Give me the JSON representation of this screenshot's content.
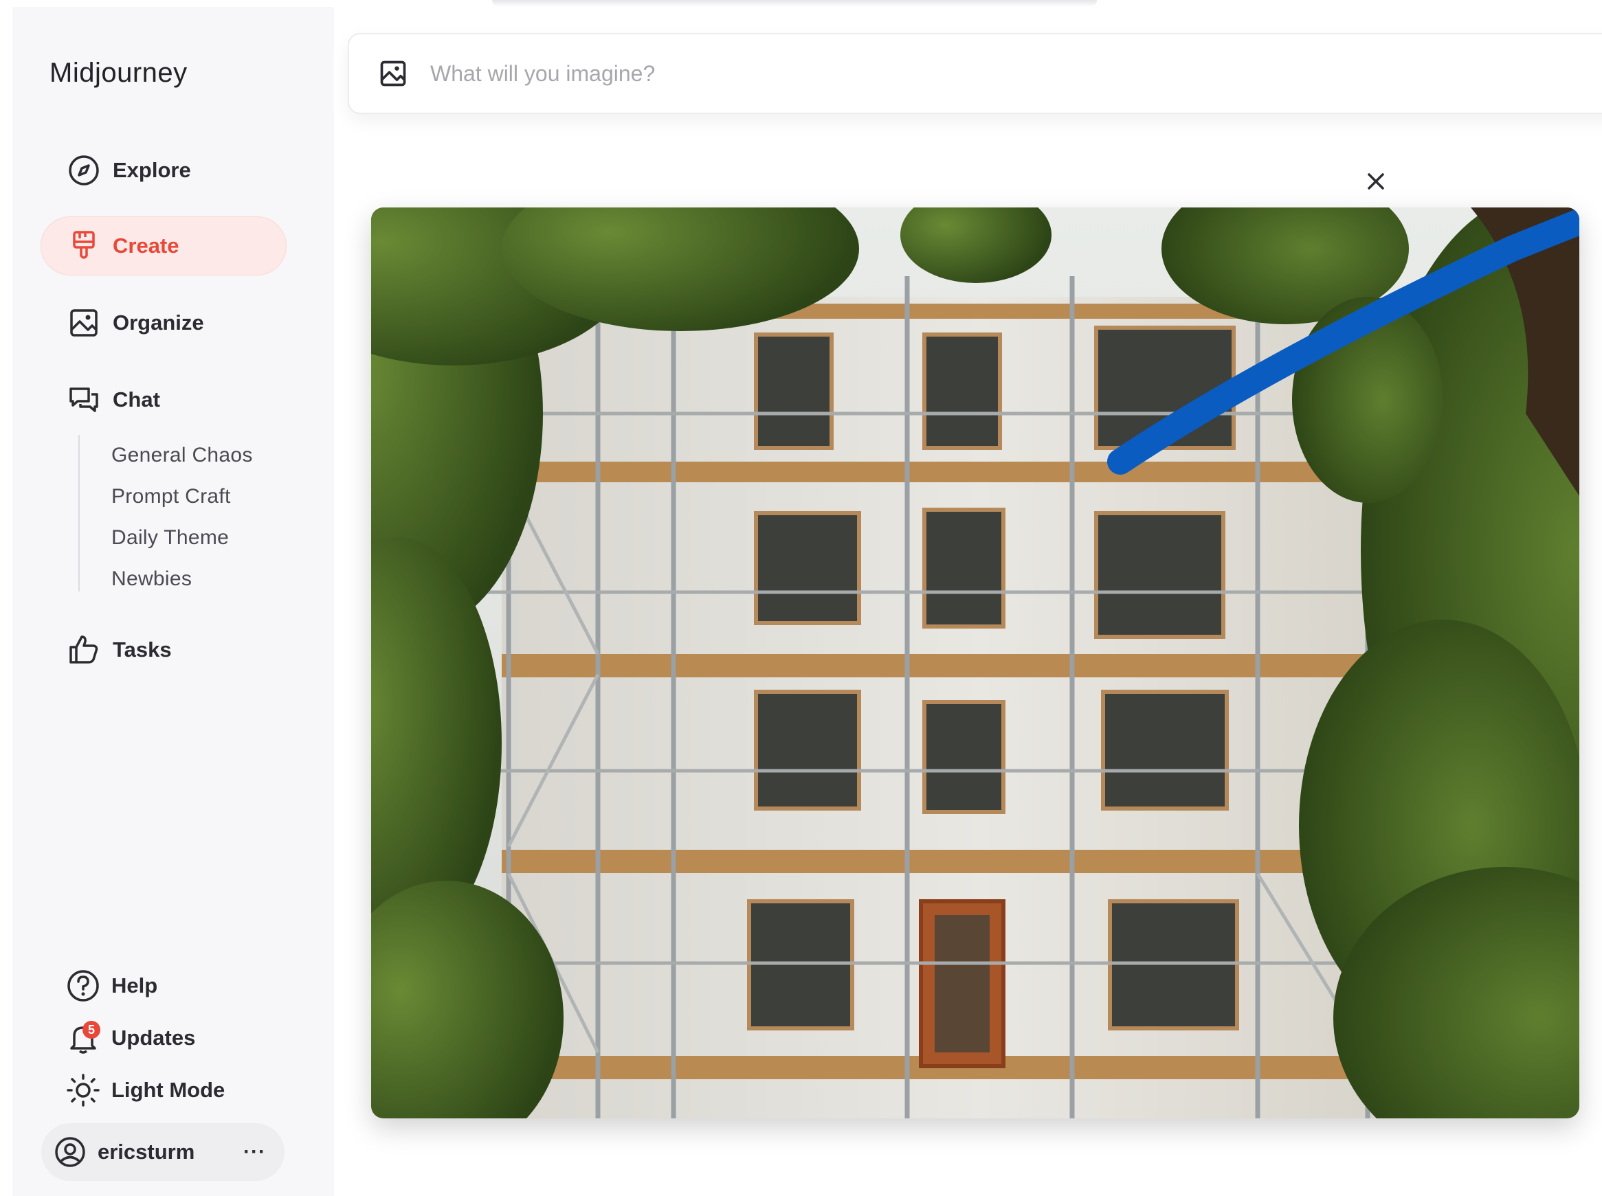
{
  "app": {
    "title": "Midjourney"
  },
  "nav": {
    "explore": "Explore",
    "create": "Create",
    "organize": "Organize",
    "chat": "Chat",
    "chat_rooms": [
      "General Chaos",
      "Prompt Craft",
      "Daily Theme",
      "Newbies"
    ],
    "tasks": "Tasks"
  },
  "footer": {
    "help": "Help",
    "updates": "Updates",
    "updates_count": "5",
    "light_mode": "Light Mode",
    "username": "ericsturm",
    "more": "···"
  },
  "prompt": {
    "placeholder": "What will you imagine?",
    "value": ""
  },
  "viewer": {
    "close": "×",
    "image_subject": "building-under-construction-with-scaffolding",
    "annotation_color": "#0a5cc0"
  },
  "colors": {
    "accent": "#e8483a",
    "active_bg": "#fde9e7",
    "sidebar_bg": "#f7f6f8"
  }
}
